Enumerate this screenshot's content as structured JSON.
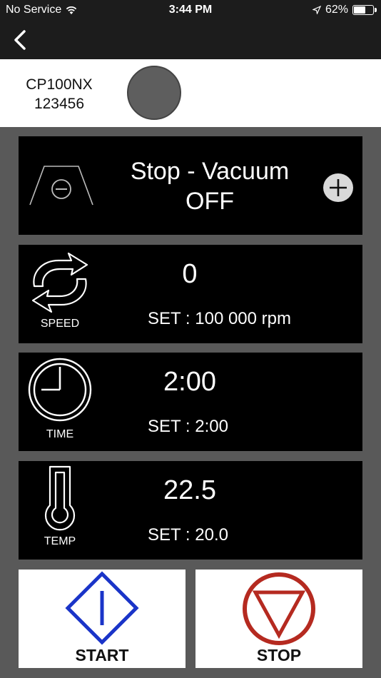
{
  "status_bar": {
    "carrier": "No Service",
    "time": "3:44 PM",
    "battery_percent": "62%",
    "battery_level": 0.62
  },
  "device": {
    "model": "CP100NX",
    "serial": "123456",
    "status_color": "#5e5e5e"
  },
  "vacuum": {
    "line1": "Stop - Vacuum",
    "line2": "OFF"
  },
  "speed": {
    "label": "SPEED",
    "value": "0",
    "set": "SET : 100 000 rpm"
  },
  "time_panel": {
    "label": "TIME",
    "value": "2:00",
    "set": "SET : 2:00"
  },
  "temp": {
    "label": "TEMP",
    "value": "22.5",
    "set": "SET : 20.0"
  },
  "buttons": {
    "start": "START",
    "stop": "STOP",
    "start_color": "#1a34c8",
    "stop_color": "#b52a20"
  }
}
